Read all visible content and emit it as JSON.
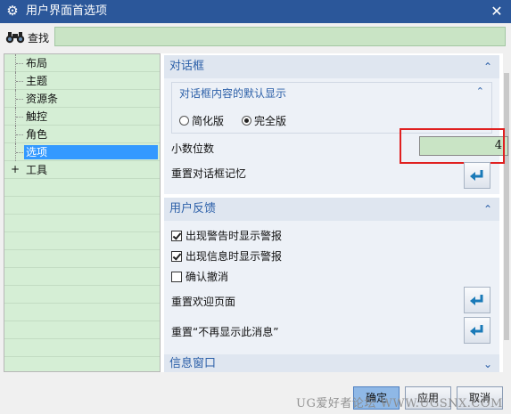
{
  "window": {
    "title": "用户界面首选项",
    "close_glyph": "✕",
    "icon": "gear-icon"
  },
  "search": {
    "label": "查找",
    "value": "",
    "icon": "binoculars-icon"
  },
  "tree": {
    "items": [
      {
        "label": "布局",
        "expander": ""
      },
      {
        "label": "主题",
        "expander": ""
      },
      {
        "label": "资源条",
        "expander": ""
      },
      {
        "label": "触控",
        "expander": ""
      },
      {
        "label": "角色",
        "expander": ""
      },
      {
        "label": "选项",
        "expander": "",
        "selected": true
      },
      {
        "label": "工具",
        "expander": "+"
      }
    ]
  },
  "dialog_section": {
    "title": "对话框",
    "subgroup_title": "对话框内容的默认显示",
    "radio_simplified": "简化版",
    "radio_full": "完全版",
    "selected_radio": "完全版",
    "decimal_label": "小数位数",
    "decimal_value": "4",
    "reset_memory_label": "重置对话框记忆"
  },
  "feedback_section": {
    "title": "用户反馈",
    "check_warning": "出现警告时显示警报",
    "check_info": "出现信息时显示警报",
    "check_undo": "确认撤消",
    "checked": [
      true,
      true,
      false
    ],
    "reset_welcome_label": "重置欢迎页面",
    "reset_dont_show_label": "重置“不再显示此消息”"
  },
  "info_section": {
    "title": "信息窗口"
  },
  "footer": {
    "ok": "确定",
    "apply": "应用",
    "cancel": "取消"
  },
  "watermark": "UG爱好者论坛 WWW.UGSNX.COM",
  "colors": {
    "title_bar": "#2b579a",
    "tree_bg": "#d5eed5",
    "selection": "#3399ff",
    "section_header_text": "#2b5fa8",
    "highlight_frame": "#e02020"
  }
}
